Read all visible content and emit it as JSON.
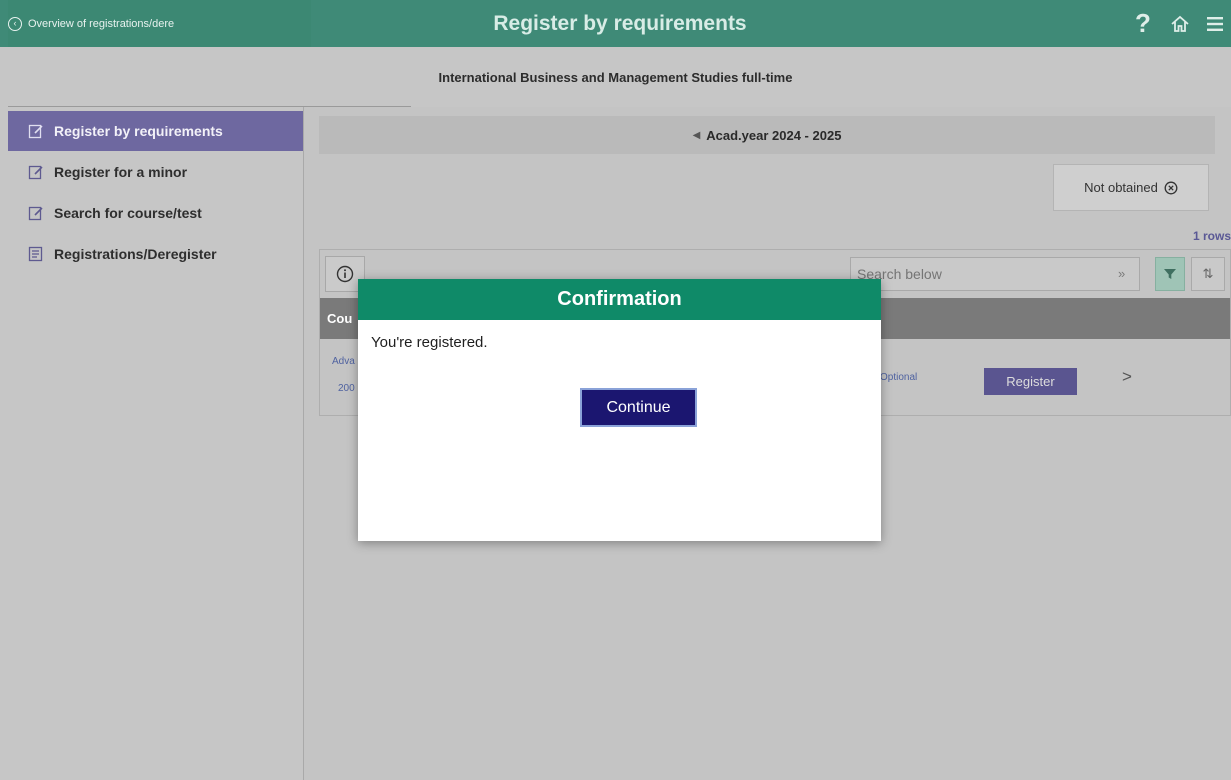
{
  "header": {
    "back_label": "Overview of registrations/dere",
    "title": "Register by requirements",
    "help_icon": "?",
    "home_icon": "home-icon",
    "menu_icon": "hamburger-menu-icon"
  },
  "subheader": {
    "program": "International Business and Management Studies full-time"
  },
  "sidebar": {
    "items": [
      {
        "label": "Register by requirements",
        "icon": "edit-icon",
        "active": true
      },
      {
        "label": "Register for a minor",
        "icon": "edit-icon"
      },
      {
        "label": "Search for course/test",
        "icon": "edit-icon"
      },
      {
        "label": "Registrations/Deregister",
        "icon": "list-icon"
      }
    ]
  },
  "main": {
    "acad_year": "Acad.year 2024 - 2025",
    "filter_chip": "Not obtained",
    "rows_count": "1 rows",
    "search_placeholder": "Search below",
    "search_arrow": "»",
    "sort_symbol": "⇅",
    "table": {
      "header_first": "Cou",
      "row": {
        "course_fragment": "Adva",
        "year_fragment": "200",
        "optional": "Optional",
        "register_label": "Register",
        "chevron": ">"
      }
    }
  },
  "modal": {
    "title": "Confirmation",
    "message": "You're registered.",
    "continue_label": "Continue"
  },
  "colors": {
    "topbar": "#3f8a77",
    "modal_header": "#0f8a68",
    "continue_button": "#1b1670",
    "active_sidebar": "#6e68a0"
  }
}
